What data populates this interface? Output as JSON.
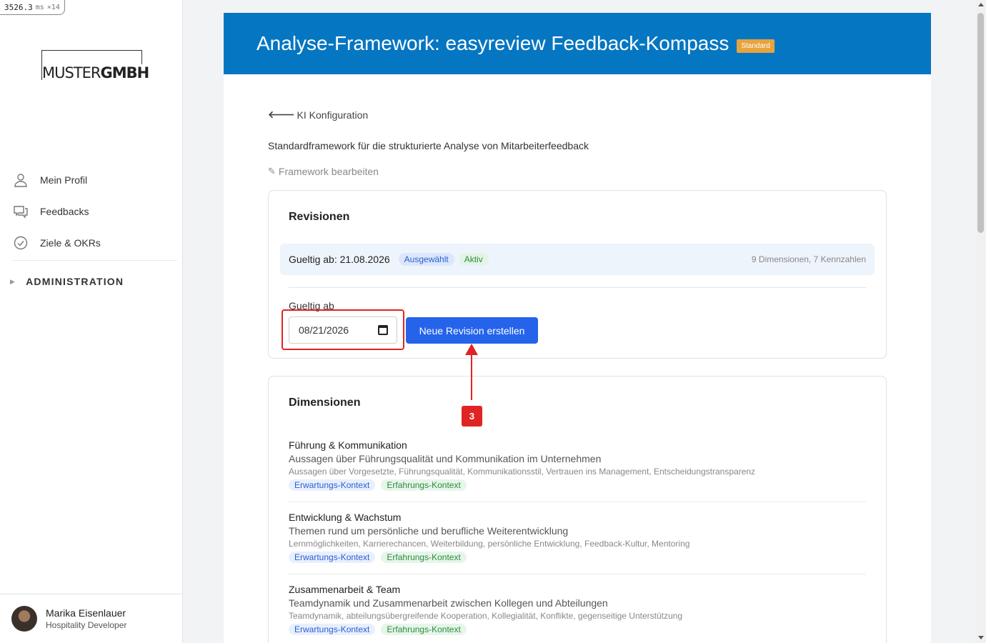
{
  "perf": {
    "value": "3526.3",
    "unit": "ms",
    "count": "×14"
  },
  "logo": {
    "light": "MUSTER",
    "bold": "GMBH"
  },
  "sidebar": {
    "items": [
      {
        "label": "Mein Profil",
        "icon": "user-icon"
      },
      {
        "label": "Feedbacks",
        "icon": "chat-icon"
      },
      {
        "label": "Ziele & OKRs",
        "icon": "check-circle-icon"
      }
    ],
    "admin": "ADMINISTRATION"
  },
  "user": {
    "name": "Marika Eisenlauer",
    "role": "Hospitality Developer"
  },
  "header": {
    "title": "Analyse-Framework: easyreview Feedback-Kompass",
    "badge": "Standard"
  },
  "back_link": "KI Konfiguration",
  "description": "Standardframework für die strukturierte Analyse von Mitarbeiterfeedback",
  "edit_link": "Framework bearbeiten",
  "revisions": {
    "title": "Revisionen",
    "row": {
      "label": "Gueltig ab: 21.08.2026",
      "selected": "Ausgewählt",
      "active": "Aktiv",
      "meta": "9 Dimensionen, 7 Kennzahlen"
    },
    "date_label": "Gueltig ab",
    "date_value": "08/21/2026",
    "button": "Neue Revision erstellen"
  },
  "annotation": {
    "step": "3",
    "color": "#e02424"
  },
  "dimensions": {
    "title": "Dimensionen",
    "items": [
      {
        "title": "Führung & Kommunikation",
        "subtitle": "Aussagen über Führungsqualität und Kommunikation im Unternehmen",
        "keywords": "Aussagen über Vorgesetzte, Führungsqualität, Kommunikationsstil, Vertrauen ins Management, Entscheidungstransparenz",
        "tag1": "Erwartungs-Kontext",
        "tag2": "Erfahrungs-Kontext"
      },
      {
        "title": "Entwicklung & Wachstum",
        "subtitle": "Themen rund um persönliche und berufliche Weiterentwicklung",
        "keywords": "Lernmöglichkeiten, Karrierechancen, Weiterbildung, persönliche Entwicklung, Feedback-Kultur, Mentoring",
        "tag1": "Erwartungs-Kontext",
        "tag2": "Erfahrungs-Kontext"
      },
      {
        "title": "Zusammenarbeit & Team",
        "subtitle": "Teamdynamik und Zusammenarbeit zwischen Kollegen und Abteilungen",
        "keywords": "Teamdynamik, abteilungsübergreifende Kooperation, Kollegialität, Konflikte, gegenseitige Unterstützung",
        "tag1": "Erwartungs-Kontext",
        "tag2": "Erfahrungs-Kontext"
      }
    ]
  },
  "colors": {
    "header": "#0576c2",
    "primary_button": "#2563eb",
    "badge": "#e8a33d"
  }
}
